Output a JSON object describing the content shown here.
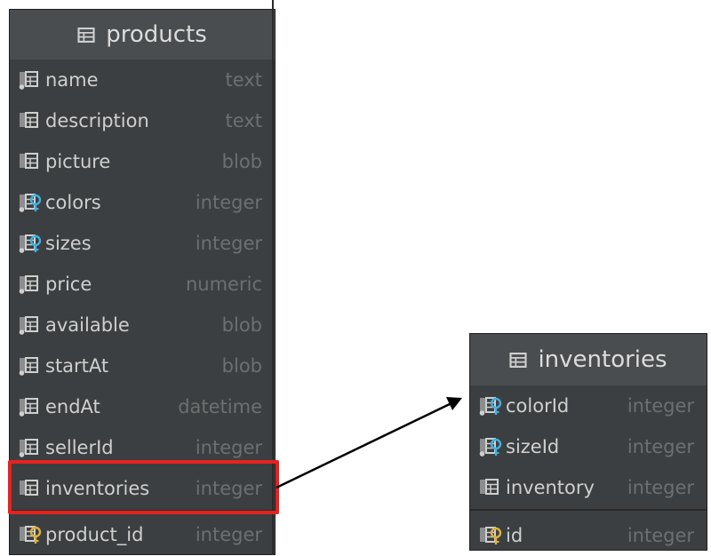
{
  "products": {
    "title": "products",
    "columns": [
      {
        "name": "name",
        "type": "text",
        "icon": "column-icon"
      },
      {
        "name": "description",
        "type": "text",
        "icon": "table-column-icon"
      },
      {
        "name": "picture",
        "type": "blob",
        "icon": "table-column-icon"
      },
      {
        "name": "colors",
        "type": "integer",
        "icon": "foreign-key-icon"
      },
      {
        "name": "sizes",
        "type": "integer",
        "icon": "foreign-key-icon"
      },
      {
        "name": "price",
        "type": "numeric",
        "icon": "column-icon"
      },
      {
        "name": "available",
        "type": "blob",
        "icon": "column-icon"
      },
      {
        "name": "startAt",
        "type": "blob",
        "icon": "column-icon"
      },
      {
        "name": "endAt",
        "type": "datetime",
        "icon": "column-icon"
      },
      {
        "name": "sellerId",
        "type": "integer",
        "icon": "column-icon"
      },
      {
        "name": "inventories",
        "type": "integer",
        "icon": "table-column-icon"
      }
    ],
    "key_column": {
      "name": "product_id",
      "type": "integer",
      "icon": "primary-key-icon"
    }
  },
  "inventories": {
    "title": "inventories",
    "columns": [
      {
        "name": "colorId",
        "type": "integer",
        "icon": "foreign-key-icon"
      },
      {
        "name": "sizeId",
        "type": "integer",
        "icon": "foreign-key-icon"
      },
      {
        "name": "inventory",
        "type": "integer",
        "icon": "table-column-icon"
      }
    ],
    "key_column": {
      "name": "id",
      "type": "integer",
      "icon": "primary-key-icon"
    }
  },
  "colors": {
    "panel_bg": "#3c3f41",
    "header_bg": "#4a4d50",
    "name_text": "#cfcfcf",
    "type_text": "#6d6f70",
    "highlight": "#e8211f",
    "pk_key": "#e0b23a",
    "fk_key": "#3fb0e0"
  }
}
